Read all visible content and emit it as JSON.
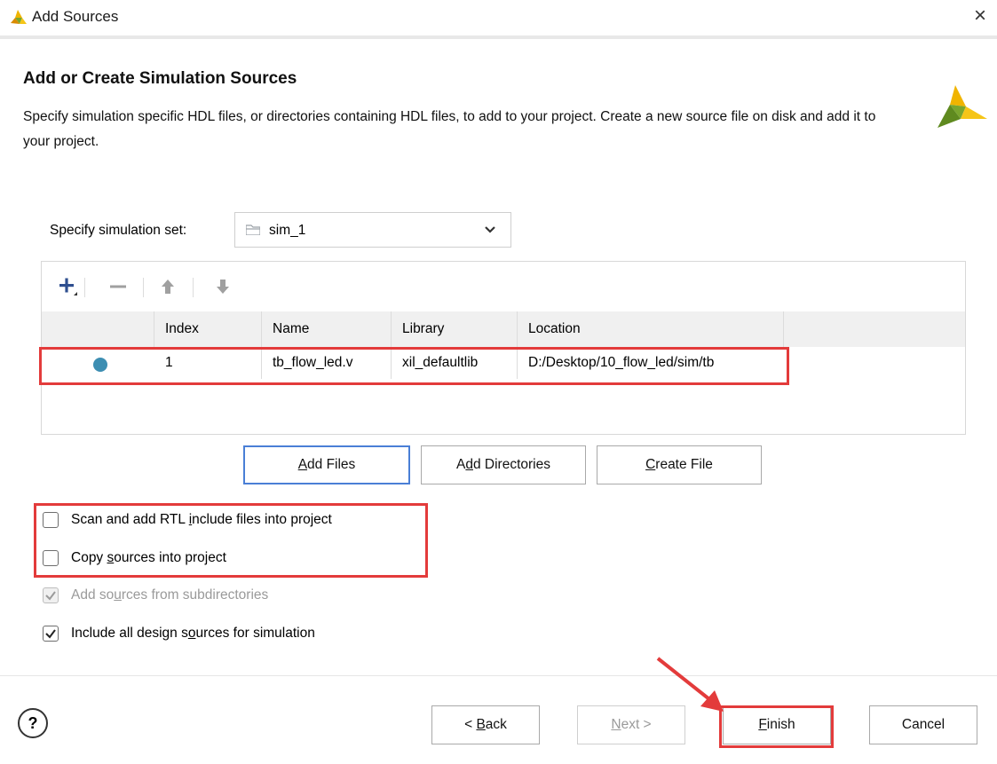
{
  "window": {
    "title": "Add Sources",
    "close_glyph": "×",
    "logo_icon": "vivado-logo-icon",
    "close_icon": "close-icon"
  },
  "header": {
    "title": "Add or Create Simulation Sources",
    "description": "Specify simulation specific HDL files, or directories containing HDL files, to add to your project. Create a new source file on disk and add it to your project."
  },
  "simulation_set": {
    "label": "Specify simulation set:",
    "value": "sim_1",
    "icon": "folder-icon"
  },
  "toolbar": {
    "icons": [
      "add-icon",
      "remove-icon",
      "move-up-icon",
      "move-down-icon"
    ]
  },
  "table": {
    "columns": [
      "",
      "Index",
      "Name",
      "Library",
      "Location"
    ],
    "rows": [
      {
        "status": "status-dot-icon",
        "index": "1",
        "name": "tb_flow_led.v",
        "library": "xil_defaultlib",
        "location": "D:/Desktop/10_flow_led/sim/tb"
      }
    ]
  },
  "buttons": {
    "add_files": {
      "pre": "",
      "key": "A",
      "post": "dd Files"
    },
    "add_directories": {
      "pre": "A",
      "key": "d",
      "post": "d Directories"
    },
    "create_file": {
      "pre": "",
      "key": "C",
      "post": "reate File"
    }
  },
  "options": [
    {
      "pre": "Scan and add RTL ",
      "key": "i",
      "post": "nclude files into project",
      "checked": false,
      "enabled": true
    },
    {
      "pre": "Copy ",
      "key": "s",
      "post": "ources into project",
      "checked": false,
      "enabled": true
    },
    {
      "pre": "Add so",
      "key": "u",
      "post": "rces from subdirectories",
      "checked": true,
      "enabled": false
    },
    {
      "pre": "Include all design s",
      "key": "o",
      "post": "urces for simulation",
      "checked": true,
      "enabled": true
    }
  ],
  "footer": {
    "help": "?",
    "back": {
      "pre": "< ",
      "key": "B",
      "post": "ack"
    },
    "next": {
      "pre": "",
      "key": "N",
      "post": "ext >"
    },
    "finish": {
      "pre": "",
      "key": "F",
      "post": "inish"
    },
    "cancel": "Cancel"
  },
  "colors": {
    "highlight": "#e33b3b",
    "accent_focus": "#4a7fd6",
    "status_dot": "#3d8eb2"
  }
}
